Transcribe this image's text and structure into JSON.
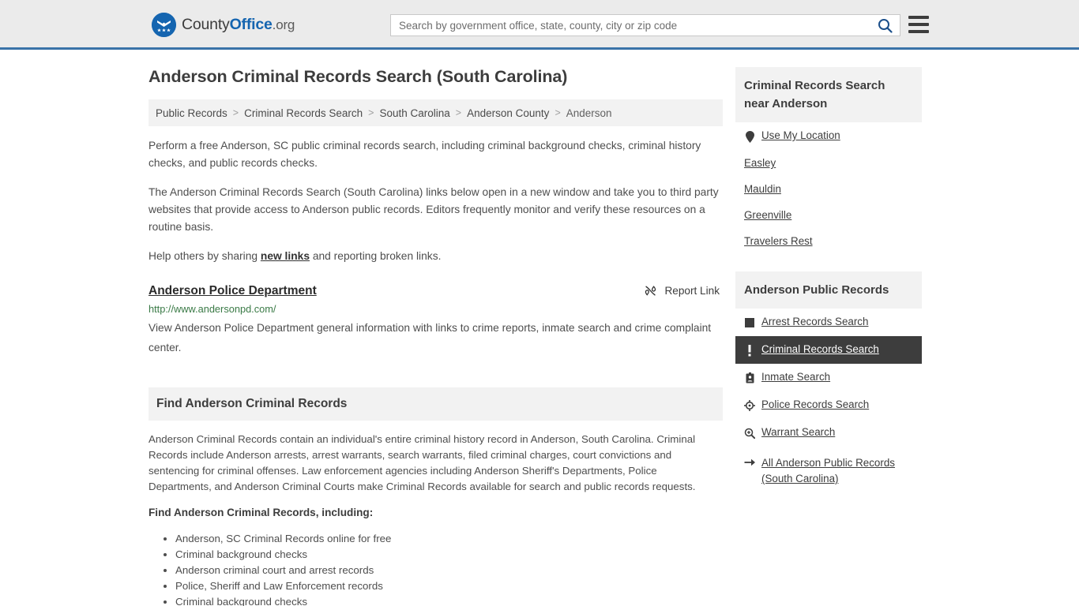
{
  "header": {
    "brand": {
      "part1": "County",
      "part2": "Office",
      "tld": ".org",
      "icon": "eagle-crest-icon"
    },
    "search": {
      "placeholder": "Search by government office, state, county, city or zip code",
      "value": "",
      "button_icon": "search-icon"
    },
    "menu_icon": "hamburger-menu-icon"
  },
  "page": {
    "title": "Anderson Criminal Records Search (South Carolina)"
  },
  "breadcrumb": {
    "separator": ">",
    "items": [
      "Public Records",
      "Criminal Records Search",
      "South Carolina",
      "Anderson County",
      "Anderson"
    ]
  },
  "intro": {
    "paragraph1": "Perform a free Anderson, SC public criminal records search, including criminal background checks, criminal history checks, and public records checks.",
    "paragraph2": "The Anderson Criminal Records Search (South Carolina) links below open in a new window and take you to third party websites that provide access to Anderson public records. Editors frequently monitor and verify these resources on a routine basis.",
    "paragraph3_before": "Help others by sharing ",
    "paragraph3_link": "new links",
    "paragraph3_after": " and reporting broken links."
  },
  "result": {
    "title": "Anderson Police Department",
    "report_label": "Report Link",
    "report_icon": "broken-link-icon",
    "url": "http://www.andersonpd.com/",
    "description": "View Anderson Police Department general information with links to crime reports, inmate search and crime complaint center."
  },
  "find_section": {
    "heading": "Find Anderson Criminal Records",
    "paragraph": "Anderson Criminal Records contain an individual's entire criminal history record in Anderson, South Carolina. Criminal Records include Anderson arrests, arrest warrants, search warrants, filed criminal charges, court convictions and sentencing for criminal offenses. Law enforcement agencies including Anderson Sheriff's Departments, Police Departments, and Anderson Criminal Courts make Criminal Records available for search and public records requests.",
    "subheading": "Find Anderson Criminal Records, including:",
    "bullets": [
      "Anderson, SC Criminal Records online for free",
      "Criminal background checks",
      "Anderson criminal court and arrest records",
      "Police, Sheriff and Law Enforcement records",
      "Criminal background checks"
    ]
  },
  "sidebar": {
    "near_section": {
      "heading": "Criminal Records Search near Anderson",
      "items": [
        {
          "label": "Use My Location",
          "icon": "map-pin-icon",
          "has_icon": true
        },
        {
          "label": "Easley",
          "icon": "",
          "has_icon": false
        },
        {
          "label": "Mauldin",
          "icon": "",
          "has_icon": false
        },
        {
          "label": "Greenville",
          "icon": "",
          "has_icon": false
        },
        {
          "label": "Travelers Rest",
          "icon": "",
          "has_icon": false
        }
      ]
    },
    "public_records_section": {
      "heading": "Anderson Public Records",
      "items": [
        {
          "label": "Arrest Records Search",
          "icon": "filled-square-icon",
          "active": false
        },
        {
          "label": "Criminal Records Search",
          "icon": "exclamation-mark-icon",
          "active": true
        },
        {
          "label": "Inmate Search",
          "icon": "id-badge-icon",
          "active": false
        },
        {
          "label": "Police Records Search",
          "icon": "crosshair-target-icon",
          "active": false
        },
        {
          "label": "Warrant Search",
          "icon": "magnifier-plus-icon",
          "active": false
        },
        {
          "label": "All Anderson Public Records (South Carolina)",
          "icon": "arrow-right-icon",
          "active": false
        }
      ]
    }
  },
  "colors": {
    "header_bg": "#ebebeb",
    "header_border": "#3a73a8",
    "brand_blue": "#1565b0",
    "band_bg": "#f2f2f2",
    "active_row_bg": "#3d3d3d",
    "url_green": "#3a7a46",
    "body_text": "#4e4e4e"
  }
}
